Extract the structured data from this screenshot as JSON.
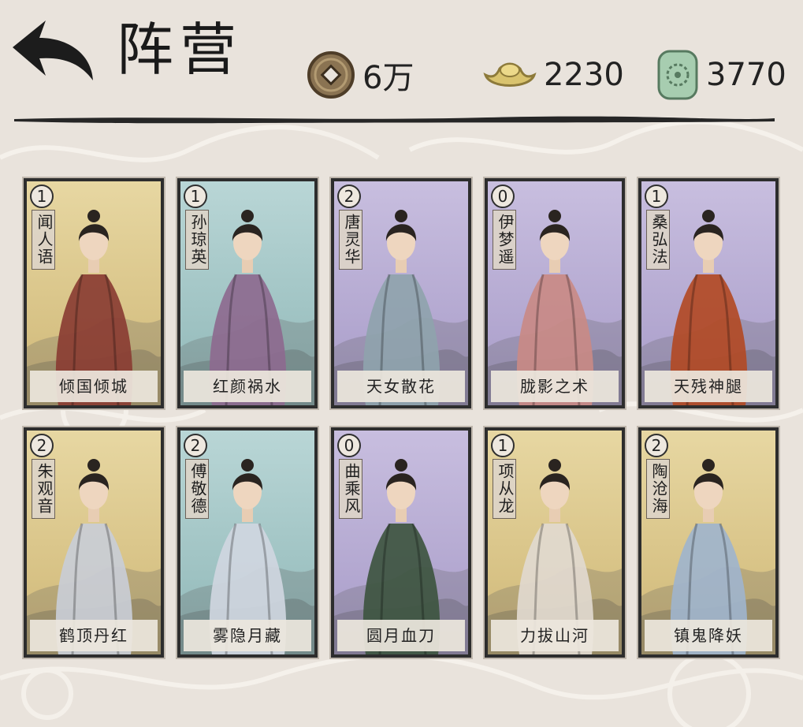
{
  "header": {
    "title": "阵营",
    "resources": [
      {
        "name": "copper-coin",
        "value": "6万"
      },
      {
        "name": "gold-ingot",
        "value": "2230"
      },
      {
        "name": "jade-token",
        "value": "3770"
      }
    ]
  },
  "colors": {
    "gold_card": "#e0cd92",
    "teal_card": "#a9c9c9",
    "purple_card": "#b9aed6",
    "ink": "#2d2d2d",
    "background": "#e9e3dc"
  },
  "cards": [
    {
      "cost": "1",
      "name": "闻人语",
      "skill": "倾国倾城",
      "frame": "gold",
      "robe": "#8a3d33"
    },
    {
      "cost": "1",
      "name": "孙琼英",
      "skill": "红颜祸水",
      "frame": "teal",
      "robe": "#8d6a8f"
    },
    {
      "cost": "2",
      "name": "唐灵华",
      "skill": "天女散花",
      "frame": "purple",
      "robe": "#8fa3ad"
    },
    {
      "cost": "0",
      "name": "伊梦遥",
      "skill": "胧影之术",
      "frame": "purple",
      "robe": "#c98a86"
    },
    {
      "cost": "1",
      "name": "桑弘法",
      "skill": "天残神腿",
      "frame": "purple",
      "robe": "#b24a25"
    },
    {
      "cost": "2",
      "name": "朱观音",
      "skill": "鹤顶丹红",
      "frame": "gold",
      "robe": "#c9cdd6"
    },
    {
      "cost": "2",
      "name": "傅敬德",
      "skill": "雾隐月藏",
      "frame": "teal",
      "robe": "#cfd6df"
    },
    {
      "cost": "0",
      "name": "曲乘风",
      "skill": "圆月血刀",
      "frame": "purple",
      "robe": "#3e5540"
    },
    {
      "cost": "1",
      "name": "项从龙",
      "skill": "力拔山河",
      "frame": "gold",
      "robe": "#e1d9cf"
    },
    {
      "cost": "2",
      "name": "陶沧海",
      "skill": "镇鬼降妖",
      "frame": "gold",
      "robe": "#9fb4cc"
    }
  ]
}
